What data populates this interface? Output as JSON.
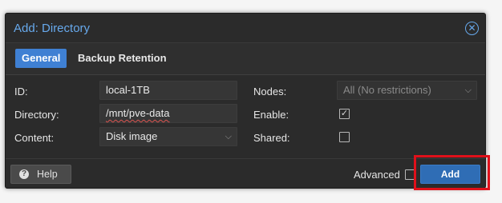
{
  "dialog": {
    "title": "Add: Directory",
    "close_icon": "close-circle-icon"
  },
  "tabs": [
    {
      "label": "General",
      "active": true
    },
    {
      "label": "Backup Retention",
      "active": false
    }
  ],
  "form": {
    "id": {
      "label": "ID:",
      "value": "local-1TB"
    },
    "directory": {
      "label": "Directory:",
      "value": "/mnt/pve-data"
    },
    "content": {
      "label": "Content:",
      "value": "Disk image"
    },
    "nodes": {
      "label": "Nodes:",
      "placeholder": "All (No restrictions)"
    },
    "enable": {
      "label": "Enable:",
      "checked": true
    },
    "shared": {
      "label": "Shared:",
      "checked": false
    }
  },
  "footer": {
    "help_label": "Help",
    "advanced_label": "Advanced",
    "advanced_checked": false,
    "add_label": "Add"
  },
  "colors": {
    "accent": "#67a9ec",
    "active_tab": "#3f80d3",
    "primary_button": "#2f6db5",
    "highlight_box": "#e0101a"
  }
}
